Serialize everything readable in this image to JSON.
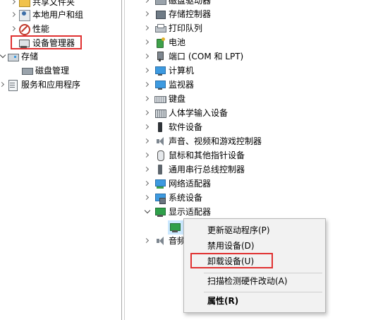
{
  "left_tree": {
    "items": [
      {
        "label": "共享文件夹",
        "icon": "share-folder-icon",
        "expander": "collapsed"
      },
      {
        "label": "本地用户和组",
        "icon": "users-icon",
        "expander": "collapsed"
      },
      {
        "label": "性能",
        "icon": "performance-icon",
        "expander": "collapsed"
      },
      {
        "label": "设备管理器",
        "icon": "device-manager-icon",
        "expander": "none",
        "highlighted": true
      },
      {
        "label": "存储",
        "icon": "storage-icon",
        "expander": "expanded"
      },
      {
        "label": "磁盘管理",
        "icon": "disk-management-icon",
        "expander": "none"
      },
      {
        "label": "服务和应用程序",
        "icon": "services-icon",
        "expander": "collapsed"
      }
    ]
  },
  "device_tree": {
    "items": [
      {
        "label": "磁盘驱动器",
        "icon": "disk-drive-icon",
        "expander": "collapsed"
      },
      {
        "label": "存储控制器",
        "icon": "storage-controller-icon",
        "expander": "collapsed"
      },
      {
        "label": "打印队列",
        "icon": "printer-icon",
        "expander": "collapsed"
      },
      {
        "label": "电池",
        "icon": "battery-icon",
        "expander": "collapsed"
      },
      {
        "label": "端口 (COM 和 LPT)",
        "icon": "port-icon",
        "expander": "collapsed"
      },
      {
        "label": "计算机",
        "icon": "computer-icon",
        "expander": "collapsed"
      },
      {
        "label": "监视器",
        "icon": "monitor-icon",
        "expander": "collapsed"
      },
      {
        "label": "键盘",
        "icon": "keyboard-icon",
        "expander": "collapsed"
      },
      {
        "label": "人体学输入设备",
        "icon": "hid-icon",
        "expander": "collapsed"
      },
      {
        "label": "软件设备",
        "icon": "software-device-icon",
        "expander": "collapsed"
      },
      {
        "label": "声音、视频和游戏控制器",
        "icon": "sound-icon",
        "expander": "collapsed"
      },
      {
        "label": "鼠标和其他指针设备",
        "icon": "mouse-icon",
        "expander": "collapsed"
      },
      {
        "label": "通用串行总线控制器",
        "icon": "usb-icon",
        "expander": "collapsed"
      },
      {
        "label": "网络适配器",
        "icon": "network-adapter-icon",
        "expander": "collapsed"
      },
      {
        "label": "系统设备",
        "icon": "system-device-icon",
        "expander": "collapsed"
      },
      {
        "label": "显示适配器",
        "icon": "display-adapter-icon",
        "expander": "expanded"
      }
    ],
    "partial_item_label": "音频"
  },
  "context_menu": {
    "items": [
      {
        "label": "更新驱动程序(P)"
      },
      {
        "label": "禁用设备(D)"
      },
      {
        "label": "卸载设备(U)",
        "highlighted": true
      },
      {
        "label": "扫描检测硬件改动(A)"
      },
      {
        "label": "属性(R)",
        "bold": true
      }
    ]
  },
  "colors": {
    "highlight_box": "#e03131",
    "selection": "#cce8ff",
    "menu_background": "#f2f2f2"
  }
}
